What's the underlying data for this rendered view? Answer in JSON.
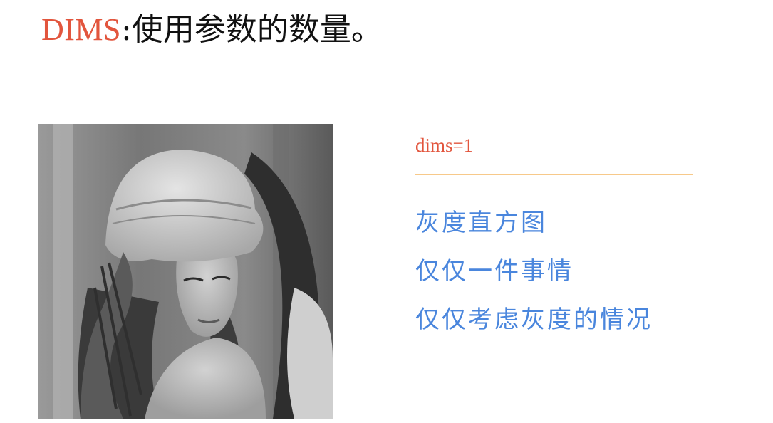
{
  "title": {
    "keyword": "DIMS",
    "rest": ":使用参数的数量。"
  },
  "image": {
    "subject": "grayscale portrait photo of a woman wearing a wide-brimmed hat with a feather"
  },
  "parameter_label": "dims=1",
  "bullets": [
    "灰度直方图",
    "仅仅一件事情",
    "仅仅考虑灰度的情况"
  ],
  "colors": {
    "keyword": "#e2553d",
    "divider": "#f7c98a",
    "bullet_text": "#4a86dd",
    "title_text": "#111111"
  }
}
